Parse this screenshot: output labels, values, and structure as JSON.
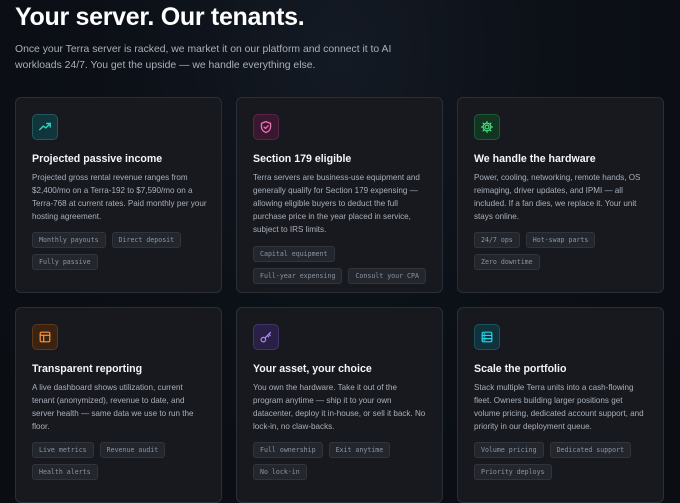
{
  "hero": {
    "title": "Your server. Our tenants.",
    "subtitle": "Once your Terra server is racked, we market it on our platform and connect it to AI workloads 24/7. You get the upside — we handle everything else."
  },
  "colors": {
    "teal": "#2dd4bf",
    "pink": "#f472b6",
    "green": "#4ade80",
    "orange": "#fb923c",
    "purple": "#a78bfa",
    "cyan": "#22d3ee"
  },
  "cards": [
    {
      "icon": "trending-up-icon",
      "title": "Projected passive income",
      "body": "Projected gross rental revenue ranges from $2,400/mo on a Terra-192 to $7,590/mo on a Terra-768 at current rates. Paid monthly per your hosting agreement.",
      "tags": [
        "Monthly payouts",
        "Direct deposit",
        "Fully passive"
      ]
    },
    {
      "icon": "shield-icon",
      "title": "Section 179 eligible",
      "body": "Terra servers are business-use equipment and generally qualify for Section 179 expensing — allowing eligible buyers to deduct the full purchase price in the year placed in service, subject to IRS limits.",
      "tags": [
        "Capital equipment",
        "Full-year expensing",
        "Consult your CPA"
      ]
    },
    {
      "icon": "gear-icon",
      "title": "We handle the hardware",
      "body": "Power, cooling, networking, remote hands, OS reimaging, driver updates, and IPMI — all included. If a fan dies, we replace it. Your unit stays online.",
      "tags": [
        "24/7 ops",
        "Hot-swap parts",
        "Zero downtime"
      ]
    },
    {
      "icon": "layout-icon",
      "title": "Transparent reporting",
      "body": "A live dashboard shows utilization, current tenant (anonymized), revenue to date, and server health — same data we use to run the floor.",
      "tags": [
        "Live metrics",
        "Revenue audit",
        "Health alerts"
      ]
    },
    {
      "icon": "key-icon",
      "title": "Your asset, your choice",
      "body": "You own the hardware. Take it out of the program anytime — ship it to your own datacenter, deploy it in-house, or sell it back. No lock-in, no claw-backs.",
      "tags": [
        "Full ownership",
        "Exit anytime",
        "No lock-in"
      ]
    },
    {
      "icon": "server-icon",
      "title": "Scale the portfolio",
      "body": "Stack multiple Terra units into a cash-flowing fleet. Owners building larger positions get volume pricing, dedicated account support, and priority in our deployment queue.",
      "tags": [
        "Volume pricing",
        "Dedicated support",
        "Priority deploys"
      ]
    }
  ]
}
